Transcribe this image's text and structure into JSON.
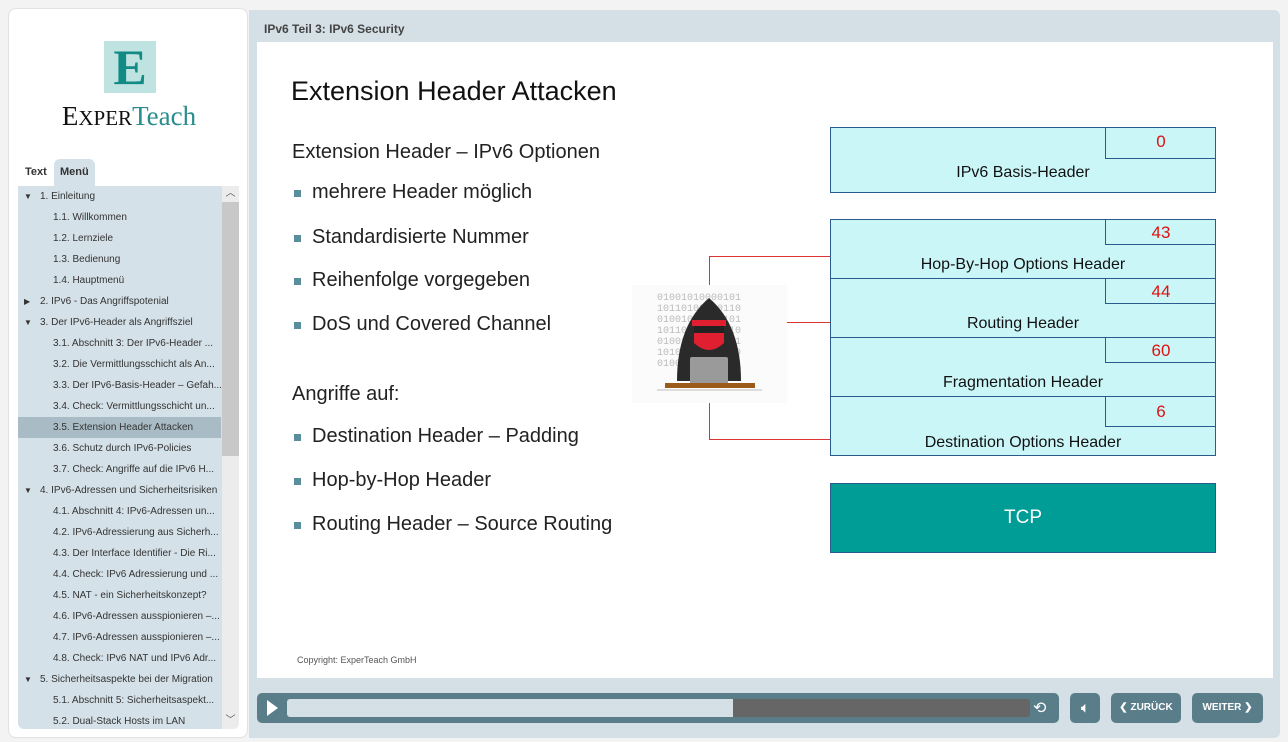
{
  "sidebar": {
    "logo_letter": "E",
    "brand_a": "E",
    "brand_b": "XPER",
    "brand_c": "T",
    "brand_d": "each",
    "tabs": [
      "Text",
      "Menü"
    ],
    "items": [
      {
        "label": "1. Einleitung",
        "level": 1,
        "expanded": true
      },
      {
        "label": "1.1. Willkommen",
        "level": 2
      },
      {
        "label": "1.2. Lernziele",
        "level": 2
      },
      {
        "label": "1.3. Bedienung",
        "level": 2
      },
      {
        "label": "1.4. Hauptmenü",
        "level": 2
      },
      {
        "label": "2. IPv6 - Das Angriffspotenial",
        "level": 1,
        "expanded": false
      },
      {
        "label": "3. Der IPv6-Header als Angriffsziel",
        "level": 1,
        "expanded": true
      },
      {
        "label": "3.1. Abschnitt 3: Der IPv6-Header ...",
        "level": 2
      },
      {
        "label": "3.2. Die Vermittlungsschicht als An...",
        "level": 2
      },
      {
        "label": "3.3. Der IPv6-Basis-Header – Gefah...",
        "level": 2
      },
      {
        "label": "3.4. Check: Vermittlungsschicht un...",
        "level": 2
      },
      {
        "label": "3.5. Extension Header Attacken",
        "level": 2,
        "selected": true
      },
      {
        "label": "3.6. Schutz durch IPv6-Policies",
        "level": 2
      },
      {
        "label": "3.7. Check: Angriffe auf die IPv6 H...",
        "level": 2
      },
      {
        "label": "4. IPv6-Adressen und Sicherheitsrisiken",
        "level": 1,
        "expanded": true
      },
      {
        "label": "4.1. Abschnitt 4: IPv6-Adressen un...",
        "level": 2
      },
      {
        "label": "4.2. IPv6-Adressierung aus Sicherh...",
        "level": 2
      },
      {
        "label": "4.3. Der Interface Identifier - Die Ri...",
        "level": 2
      },
      {
        "label": "4.4. Check: IPv6 Adressierung und ...",
        "level": 2
      },
      {
        "label": "4.5. NAT - ein Sicherheitskonzept?",
        "level": 2
      },
      {
        "label": "4.6. IPv6-Adressen ausspionieren –...",
        "level": 2
      },
      {
        "label": "4.7. IPv6-Adressen ausspionieren –...",
        "level": 2
      },
      {
        "label": "4.8. Check: IPv6 NAT und IPv6 Adr...",
        "level": 2
      },
      {
        "label": "5. Sicherheitsaspekte bei der Migration",
        "level": 1,
        "expanded": true
      },
      {
        "label": "5.1. Abschnitt 5: Sicherheitsaspekt...",
        "level": 2
      },
      {
        "label": "5.2. Dual-Stack Hosts im LAN",
        "level": 2
      }
    ]
  },
  "header": {
    "title": "IPv6 Teil 3: IPv6 Security"
  },
  "slide": {
    "title": "Extension Header Attacken",
    "heading1": "Extension Header – IPv6 Optionen",
    "bullets1": [
      "mehrere Header möglich",
      "Standardisierte Nummer",
      "Reihenfolge vorgegeben",
      "DoS und Covered Channel"
    ],
    "heading2": "Angriffe auf:",
    "bullets2": [
      "Destination Header – Padding",
      "Hop-by-Hop Header",
      "Routing Header – Source Routing"
    ],
    "basis": {
      "label": "IPv6 Basis-Header",
      "number": "0"
    },
    "ext": [
      {
        "label": "Hop-By-Hop Options Header",
        "number": "43"
      },
      {
        "label": "Routing Header",
        "number": "44"
      },
      {
        "label": "Fragmentation Header",
        "number": "60"
      },
      {
        "label": "Destination Options Header",
        "number": "6"
      }
    ],
    "tcp": "TCP",
    "binary": [
      "01001010000101",
      "10110100100110",
      "01001001000101",
      "10110101100110",
      "01001100010101",
      "10101001000110",
      "01001010100101"
    ],
    "copyright": "Copyright: ExperTeach GmbH"
  },
  "controls": {
    "progress_percent": 60,
    "back": "ZURÜCK",
    "next": "WEITER"
  },
  "colors": {
    "accent": "#5a7d8a",
    "tcp": "#009c96",
    "box": "#cbf6f8",
    "number": "#dd1111"
  }
}
